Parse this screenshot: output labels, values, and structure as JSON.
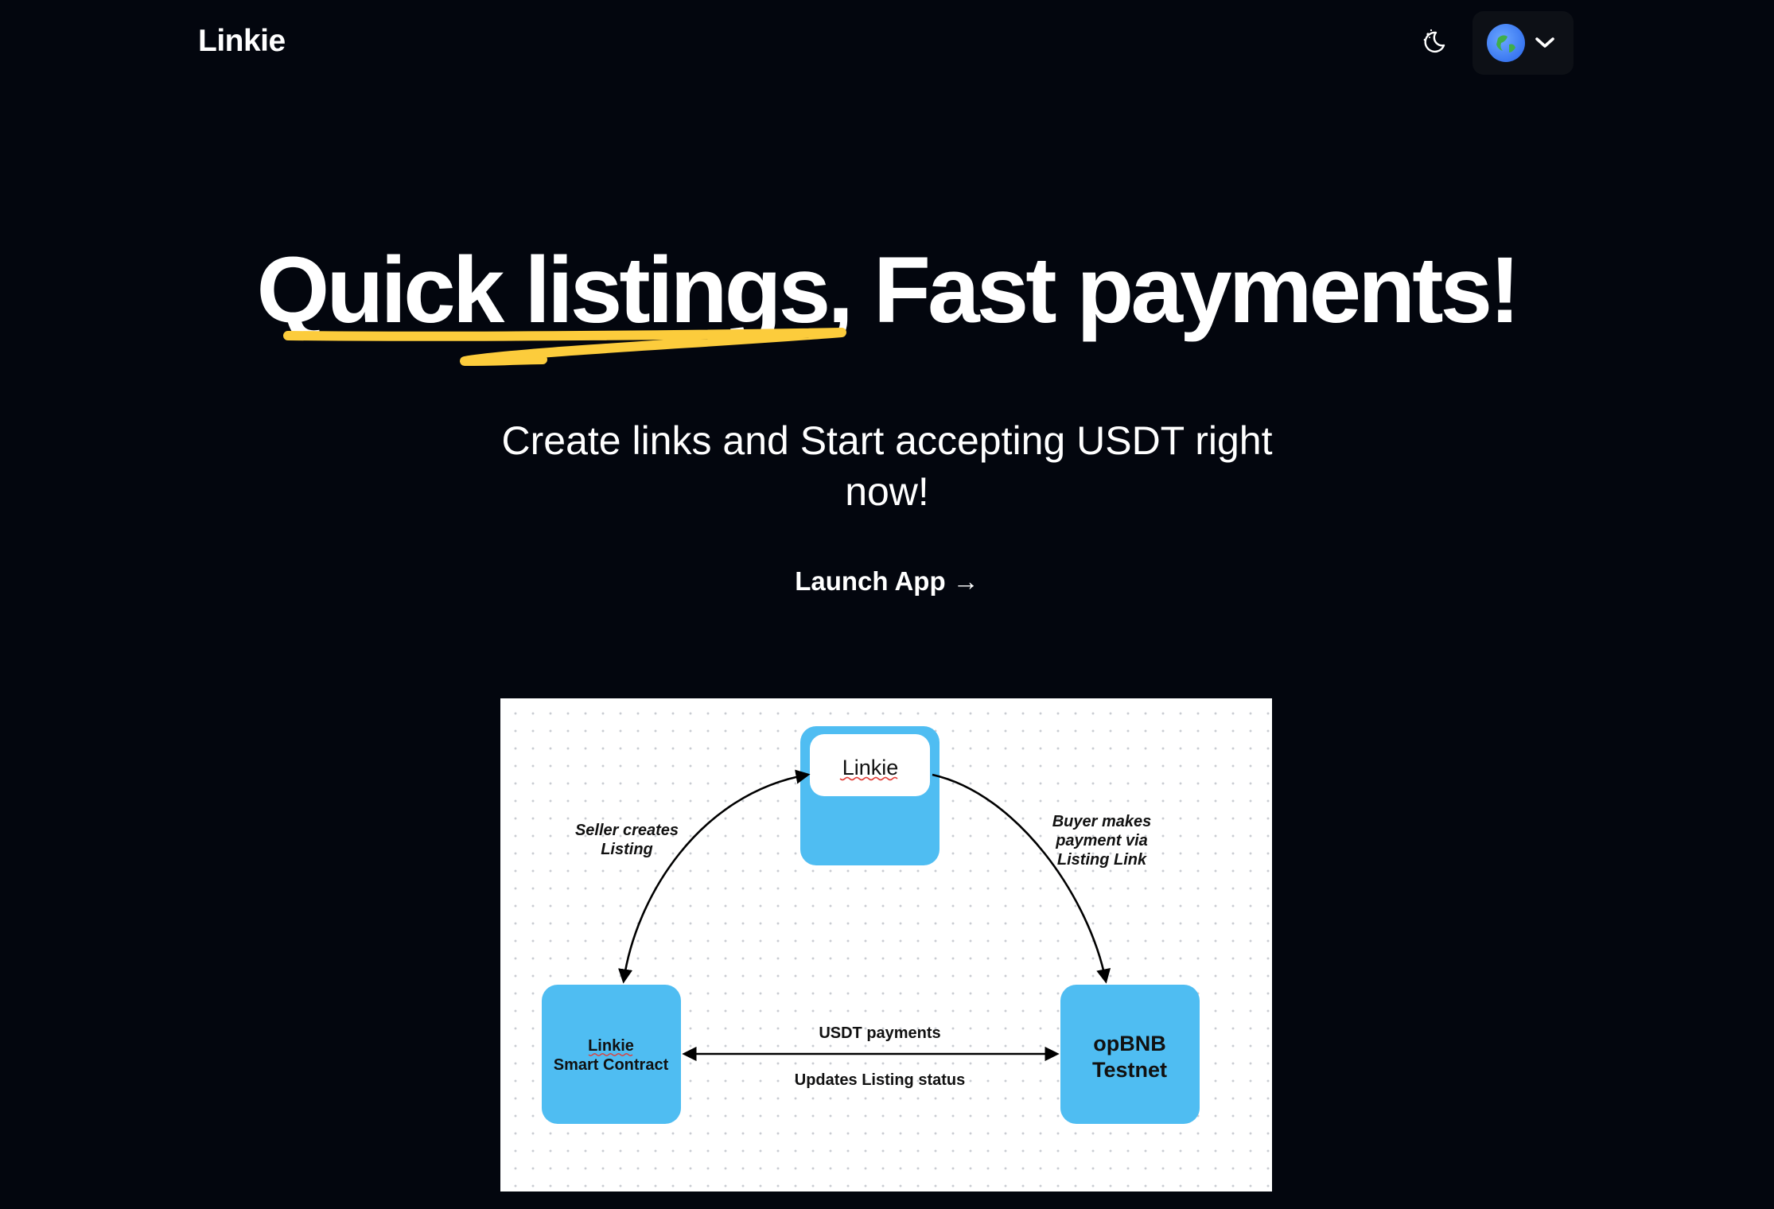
{
  "header": {
    "brand": "Linkie",
    "theme_toggle_icon": "moon-stars-icon",
    "network_icon": "globe-icon",
    "network_chevron_icon": "chevron-down-icon"
  },
  "hero": {
    "title_part1": "Quick listings,",
    "title_part2": "Fast payments!",
    "underline_color": "#fccc3c",
    "subtitle": "Create links and Start accepting USDT right now!",
    "cta": "Launch App →"
  },
  "diagram": {
    "box_color": "#4fbdf2",
    "nodes": {
      "top": "Linkie",
      "left_line1": "Linkie",
      "left_line2": "Smart Contract",
      "right_line1": "opBNB",
      "right_line2": "Testnet"
    },
    "edges": {
      "seller_line1": "Seller creates",
      "seller_line2": "Listing",
      "buyer_line1": "Buyer makes",
      "buyer_line2": "payment via",
      "buyer_line3": "Listing Link",
      "usdt": "USDT payments",
      "updates": "Updates Listing status"
    }
  }
}
